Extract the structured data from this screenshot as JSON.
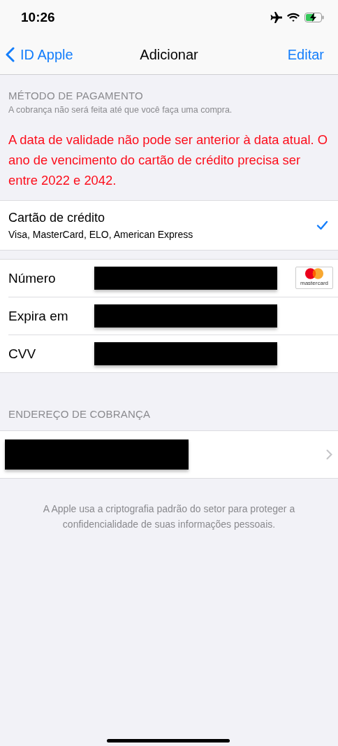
{
  "status_bar": {
    "time": "10:26",
    "airplane_mode": true
  },
  "nav": {
    "back": "ID Apple",
    "title": "Adicionar",
    "action": "Editar"
  },
  "payment_section": {
    "header": "MÉTODO DE PAGAMENTO",
    "subtitle": "A cobrança não será feita até que você faça uma compra.",
    "error": "A data de validade não pode ser anterior à data atual. O ano de vencimento do cartão de crédito precisa ser entre 2022 e 2042."
  },
  "methods": [
    {
      "title": "Cartão de crédito",
      "subtitle": "Visa, MasterCard, ELO, American Express",
      "selected": true
    }
  ],
  "card_fields": [
    {
      "label": "Número",
      "redacted": true,
      "card_logo": "mastercard"
    },
    {
      "label": "Expira em",
      "redacted": true
    },
    {
      "label": "CVV",
      "redacted": true
    }
  ],
  "billing_section": {
    "header": "ENDEREÇO DE COBRANÇA",
    "address_redacted": true
  },
  "footer": "A Apple usa a criptografia padrão do setor para proteger a confidencialidade de suas informações pessoais."
}
